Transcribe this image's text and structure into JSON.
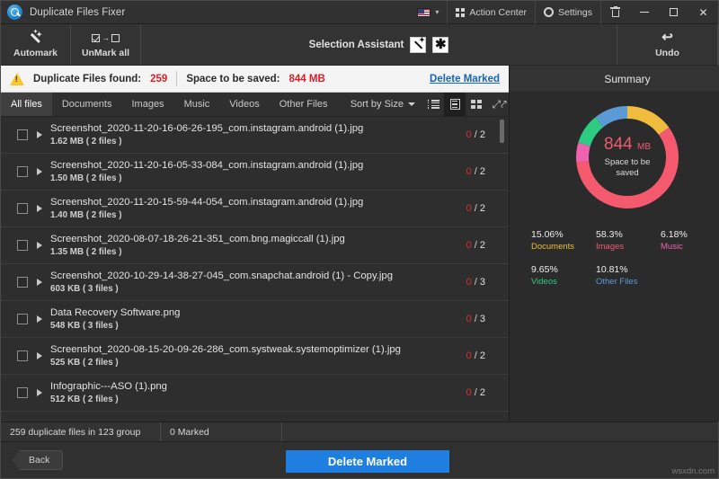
{
  "titlebar": {
    "app_title": "Duplicate Files Fixer",
    "logo_icon": "magnifier-logo-icon",
    "language_flag": "us-flag-icon",
    "language_caret": "▾",
    "action_center": "Action Center",
    "settings": "Settings",
    "bin_icon": "trash-bin-icon",
    "minimize": "—",
    "maximize": "□",
    "close": "✕"
  },
  "toolbar": {
    "automark": "Automark",
    "unmark_all": "UnMark all",
    "selection_assistant": "Selection Assistant",
    "assistant_wand_icon": "magic-wand-icon",
    "assistant_star_icon": "star-asterisk-icon",
    "undo": "Undo",
    "undo_icon": "↩"
  },
  "infobar": {
    "warning_icon": "warning-triangle-icon",
    "found_label": "Duplicate Files found:",
    "found_value": "259",
    "space_label": "Space to be saved:",
    "space_value": "844 MB",
    "delete_marked_link": "Delete Marked"
  },
  "tabs": [
    {
      "label": "All files",
      "active": true
    },
    {
      "label": "Documents",
      "active": false
    },
    {
      "label": "Images",
      "active": false
    },
    {
      "label": "Music",
      "active": false
    },
    {
      "label": "Videos",
      "active": false
    },
    {
      "label": "Other Files",
      "active": false
    }
  ],
  "sort": {
    "label": "Sort by Size"
  },
  "views": [
    {
      "name": "list-view",
      "selected": false
    },
    {
      "name": "detail-view",
      "selected": true
    },
    {
      "name": "grid-view",
      "selected": false
    },
    {
      "name": "expand-view",
      "selected": false
    }
  ],
  "files": [
    {
      "name": "Screenshot_2020-11-20-16-06-26-195_com.instagram.android (1).jpg",
      "meta": "1.62 MB  ( 2 files )",
      "marked": "0",
      "total": "2"
    },
    {
      "name": "Screenshot_2020-11-20-16-05-33-084_com.instagram.android (1).jpg",
      "meta": "1.50 MB  ( 2 files )",
      "marked": "0",
      "total": "2"
    },
    {
      "name": "Screenshot_2020-11-20-15-59-44-054_com.instagram.android (1).jpg",
      "meta": "1.40 MB  ( 2 files )",
      "marked": "0",
      "total": "2"
    },
    {
      "name": "Screenshot_2020-08-07-18-26-21-351_com.bng.magiccall (1).jpg",
      "meta": "1.35 MB  ( 2 files )",
      "marked": "0",
      "total": "2"
    },
    {
      "name": "Screenshot_2020-10-29-14-38-27-045_com.snapchat.android (1) - Copy.jpg",
      "meta": "603 KB  ( 3 files )",
      "marked": "0",
      "total": "3"
    },
    {
      "name": "Data Recovery Software.png",
      "meta": "548 KB  ( 3 files )",
      "marked": "0",
      "total": "3"
    },
    {
      "name": "Screenshot_2020-08-15-20-09-26-286_com.systweak.systemoptimizer (1).jpg",
      "meta": "525 KB  ( 2 files )",
      "marked": "0",
      "total": "2"
    },
    {
      "name": "Infographic---ASO (1).png",
      "meta": "512 KB  ( 2 files )",
      "marked": "0",
      "total": "2"
    }
  ],
  "summary": {
    "title": "Summary",
    "center_value": "844",
    "center_unit": "MB",
    "center_label_line1": "Space to be",
    "center_label_line2": "saved"
  },
  "chart_data": {
    "type": "pie",
    "title": "Summary",
    "center_text": "844 MB Space to be saved",
    "categories": [
      "Documents",
      "Images",
      "Music",
      "Videos",
      "Other Files"
    ],
    "values": [
      15.06,
      58.3,
      6.18,
      9.65,
      10.81
    ],
    "unit": "%",
    "colors": [
      "#f0bc3e",
      "#f4596e",
      "#ef62b0",
      "#2ecc82",
      "#5b9bd5"
    ],
    "legend_position": "below",
    "donut": true
  },
  "statusbar": {
    "duplicates": "259 duplicate files in 123 group",
    "marked": "0 Marked",
    "extra": ""
  },
  "footer": {
    "back": "Back",
    "delete_marked": "Delete Marked",
    "watermark": "wsxdn.com"
  }
}
